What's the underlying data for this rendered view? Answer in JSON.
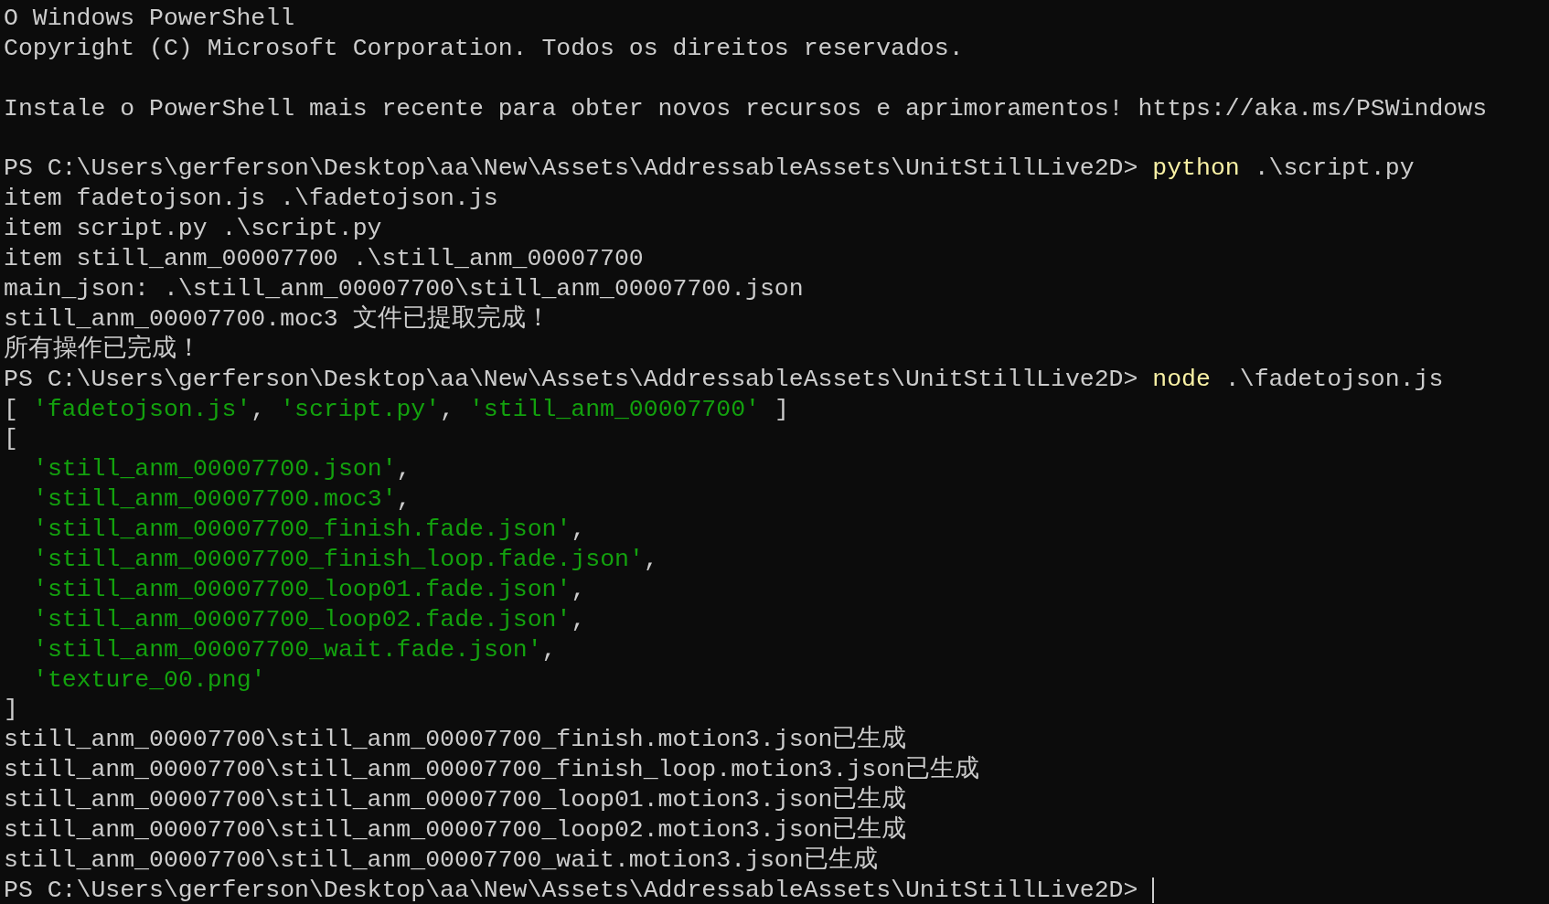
{
  "terminal": {
    "lines": [
      {
        "kind": "text",
        "segments": [
          {
            "kind": "plain",
            "text": "O Windows PowerShell"
          }
        ]
      },
      {
        "kind": "text",
        "segments": [
          {
            "kind": "plain",
            "text": "Copyright (C) Microsoft Corporation. Todos os direitos reservados."
          }
        ]
      },
      {
        "kind": "blank"
      },
      {
        "kind": "text",
        "segments": [
          {
            "kind": "plain",
            "text": "Instale o PowerShell mais recente para obter novos recursos e aprimoramentos! https://aka.ms/PSWindows"
          }
        ]
      },
      {
        "kind": "blank"
      },
      {
        "kind": "text",
        "segments": [
          {
            "kind": "plain",
            "text": "PS C:\\Users\\gerferson\\Desktop\\aa\\New\\Assets\\AddressableAssets\\UnitStillLive2D> "
          },
          {
            "kind": "command",
            "text": "python"
          },
          {
            "kind": "plain",
            "text": " .\\script.py"
          }
        ]
      },
      {
        "kind": "text",
        "segments": [
          {
            "kind": "plain",
            "text": "item fadetojson.js .\\fadetojson.js"
          }
        ]
      },
      {
        "kind": "text",
        "segments": [
          {
            "kind": "plain",
            "text": "item script.py .\\script.py"
          }
        ]
      },
      {
        "kind": "text",
        "segments": [
          {
            "kind": "plain",
            "text": "item still_anm_00007700 .\\still_anm_00007700"
          }
        ]
      },
      {
        "kind": "text",
        "segments": [
          {
            "kind": "plain",
            "text": "main_json: .\\still_anm_00007700\\still_anm_00007700.json"
          }
        ]
      },
      {
        "kind": "text",
        "segments": [
          {
            "kind": "plain",
            "text": "still_anm_00007700.moc3 文件已提取完成！"
          }
        ]
      },
      {
        "kind": "text",
        "segments": [
          {
            "kind": "plain",
            "text": "所有操作已完成！"
          }
        ]
      },
      {
        "kind": "text",
        "segments": [
          {
            "kind": "plain",
            "text": "PS C:\\Users\\gerferson\\Desktop\\aa\\New\\Assets\\AddressableAssets\\UnitStillLive2D> "
          },
          {
            "kind": "command",
            "text": "node"
          },
          {
            "kind": "plain",
            "text": " .\\fadetojson.js"
          }
        ]
      },
      {
        "kind": "text",
        "segments": [
          {
            "kind": "plain",
            "text": "[ "
          },
          {
            "kind": "string",
            "text": "'fadetojson.js'"
          },
          {
            "kind": "plain",
            "text": ", "
          },
          {
            "kind": "string",
            "text": "'script.py'"
          },
          {
            "kind": "plain",
            "text": ", "
          },
          {
            "kind": "string",
            "text": "'still_anm_00007700'"
          },
          {
            "kind": "plain",
            "text": " ]"
          }
        ]
      },
      {
        "kind": "text",
        "segments": [
          {
            "kind": "plain",
            "text": "["
          }
        ]
      },
      {
        "kind": "text",
        "indented": true,
        "segments": [
          {
            "kind": "string",
            "text": "'still_anm_00007700.json'"
          },
          {
            "kind": "plain",
            "text": ","
          }
        ]
      },
      {
        "kind": "text",
        "indented": true,
        "segments": [
          {
            "kind": "string",
            "text": "'still_anm_00007700.moc3'"
          },
          {
            "kind": "plain",
            "text": ","
          }
        ]
      },
      {
        "kind": "text",
        "indented": true,
        "segments": [
          {
            "kind": "string",
            "text": "'still_anm_00007700_finish.fade.json'"
          },
          {
            "kind": "plain",
            "text": ","
          }
        ]
      },
      {
        "kind": "text",
        "indented": true,
        "segments": [
          {
            "kind": "string",
            "text": "'still_anm_00007700_finish_loop.fade.json'"
          },
          {
            "kind": "plain",
            "text": ","
          }
        ]
      },
      {
        "kind": "text",
        "indented": true,
        "segments": [
          {
            "kind": "string",
            "text": "'still_anm_00007700_loop01.fade.json'"
          },
          {
            "kind": "plain",
            "text": ","
          }
        ]
      },
      {
        "kind": "text",
        "indented": true,
        "segments": [
          {
            "kind": "string",
            "text": "'still_anm_00007700_loop02.fade.json'"
          },
          {
            "kind": "plain",
            "text": ","
          }
        ]
      },
      {
        "kind": "text",
        "indented": true,
        "segments": [
          {
            "kind": "string",
            "text": "'still_anm_00007700_wait.fade.json'"
          },
          {
            "kind": "plain",
            "text": ","
          }
        ]
      },
      {
        "kind": "text",
        "indented": true,
        "segments": [
          {
            "kind": "string",
            "text": "'texture_00.png'"
          }
        ]
      },
      {
        "kind": "text",
        "segments": [
          {
            "kind": "plain",
            "text": "]"
          }
        ]
      },
      {
        "kind": "text",
        "segments": [
          {
            "kind": "plain",
            "text": "still_anm_00007700\\still_anm_00007700_finish.motion3.json已生成"
          }
        ]
      },
      {
        "kind": "text",
        "segments": [
          {
            "kind": "plain",
            "text": "still_anm_00007700\\still_anm_00007700_finish_loop.motion3.json已生成"
          }
        ]
      },
      {
        "kind": "text",
        "segments": [
          {
            "kind": "plain",
            "text": "still_anm_00007700\\still_anm_00007700_loop01.motion3.json已生成"
          }
        ]
      },
      {
        "kind": "text",
        "segments": [
          {
            "kind": "plain",
            "text": "still_anm_00007700\\still_anm_00007700_loop02.motion3.json已生成"
          }
        ]
      },
      {
        "kind": "text",
        "segments": [
          {
            "kind": "plain",
            "text": "still_anm_00007700\\still_anm_00007700_wait.motion3.json已生成"
          }
        ]
      },
      {
        "kind": "text",
        "cursor": true,
        "segments": [
          {
            "kind": "plain",
            "text": "PS C:\\Users\\gerferson\\Desktop\\aa\\New\\Assets\\AddressableAssets\\UnitStillLive2D> "
          }
        ]
      }
    ]
  }
}
